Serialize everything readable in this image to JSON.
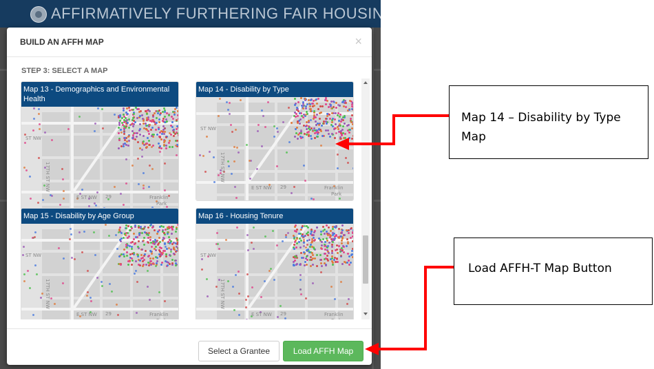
{
  "app": {
    "title": "AFFIRMATIVELY FURTHERING FAIR HOUSING",
    "brand_color": "#163b5f"
  },
  "modal": {
    "title": "BUILD AN AFFH MAP",
    "close_glyph": "×",
    "step_label": "STEP 3: SELECT A MAP",
    "cards": [
      {
        "title": "Map 13 - Demographics and Environmental Health"
      },
      {
        "title": "Map 14 - Disability by Type"
      },
      {
        "title": "Map 15 - Disability by Age Group"
      },
      {
        "title": "Map 16 - Housing Tenure"
      }
    ],
    "map_labels": {
      "st_nw": "ST NW",
      "e_st": "E ST NW",
      "num": "29",
      "franklin": "Franklin",
      "park": "Park",
      "street_17": "17TH ST NW"
    },
    "buttons": {
      "select_grantee": "Select a Grantee",
      "load_map": "Load AFFH Map"
    },
    "colors": {
      "card_header": "#0d4a80",
      "success": "#5cb85c"
    }
  },
  "annotations": {
    "callout_map14": "Map 14 – Disability by Type Map",
    "callout_load": "Load AFFH-T Map Button",
    "arrow_color": "#ff0000"
  }
}
